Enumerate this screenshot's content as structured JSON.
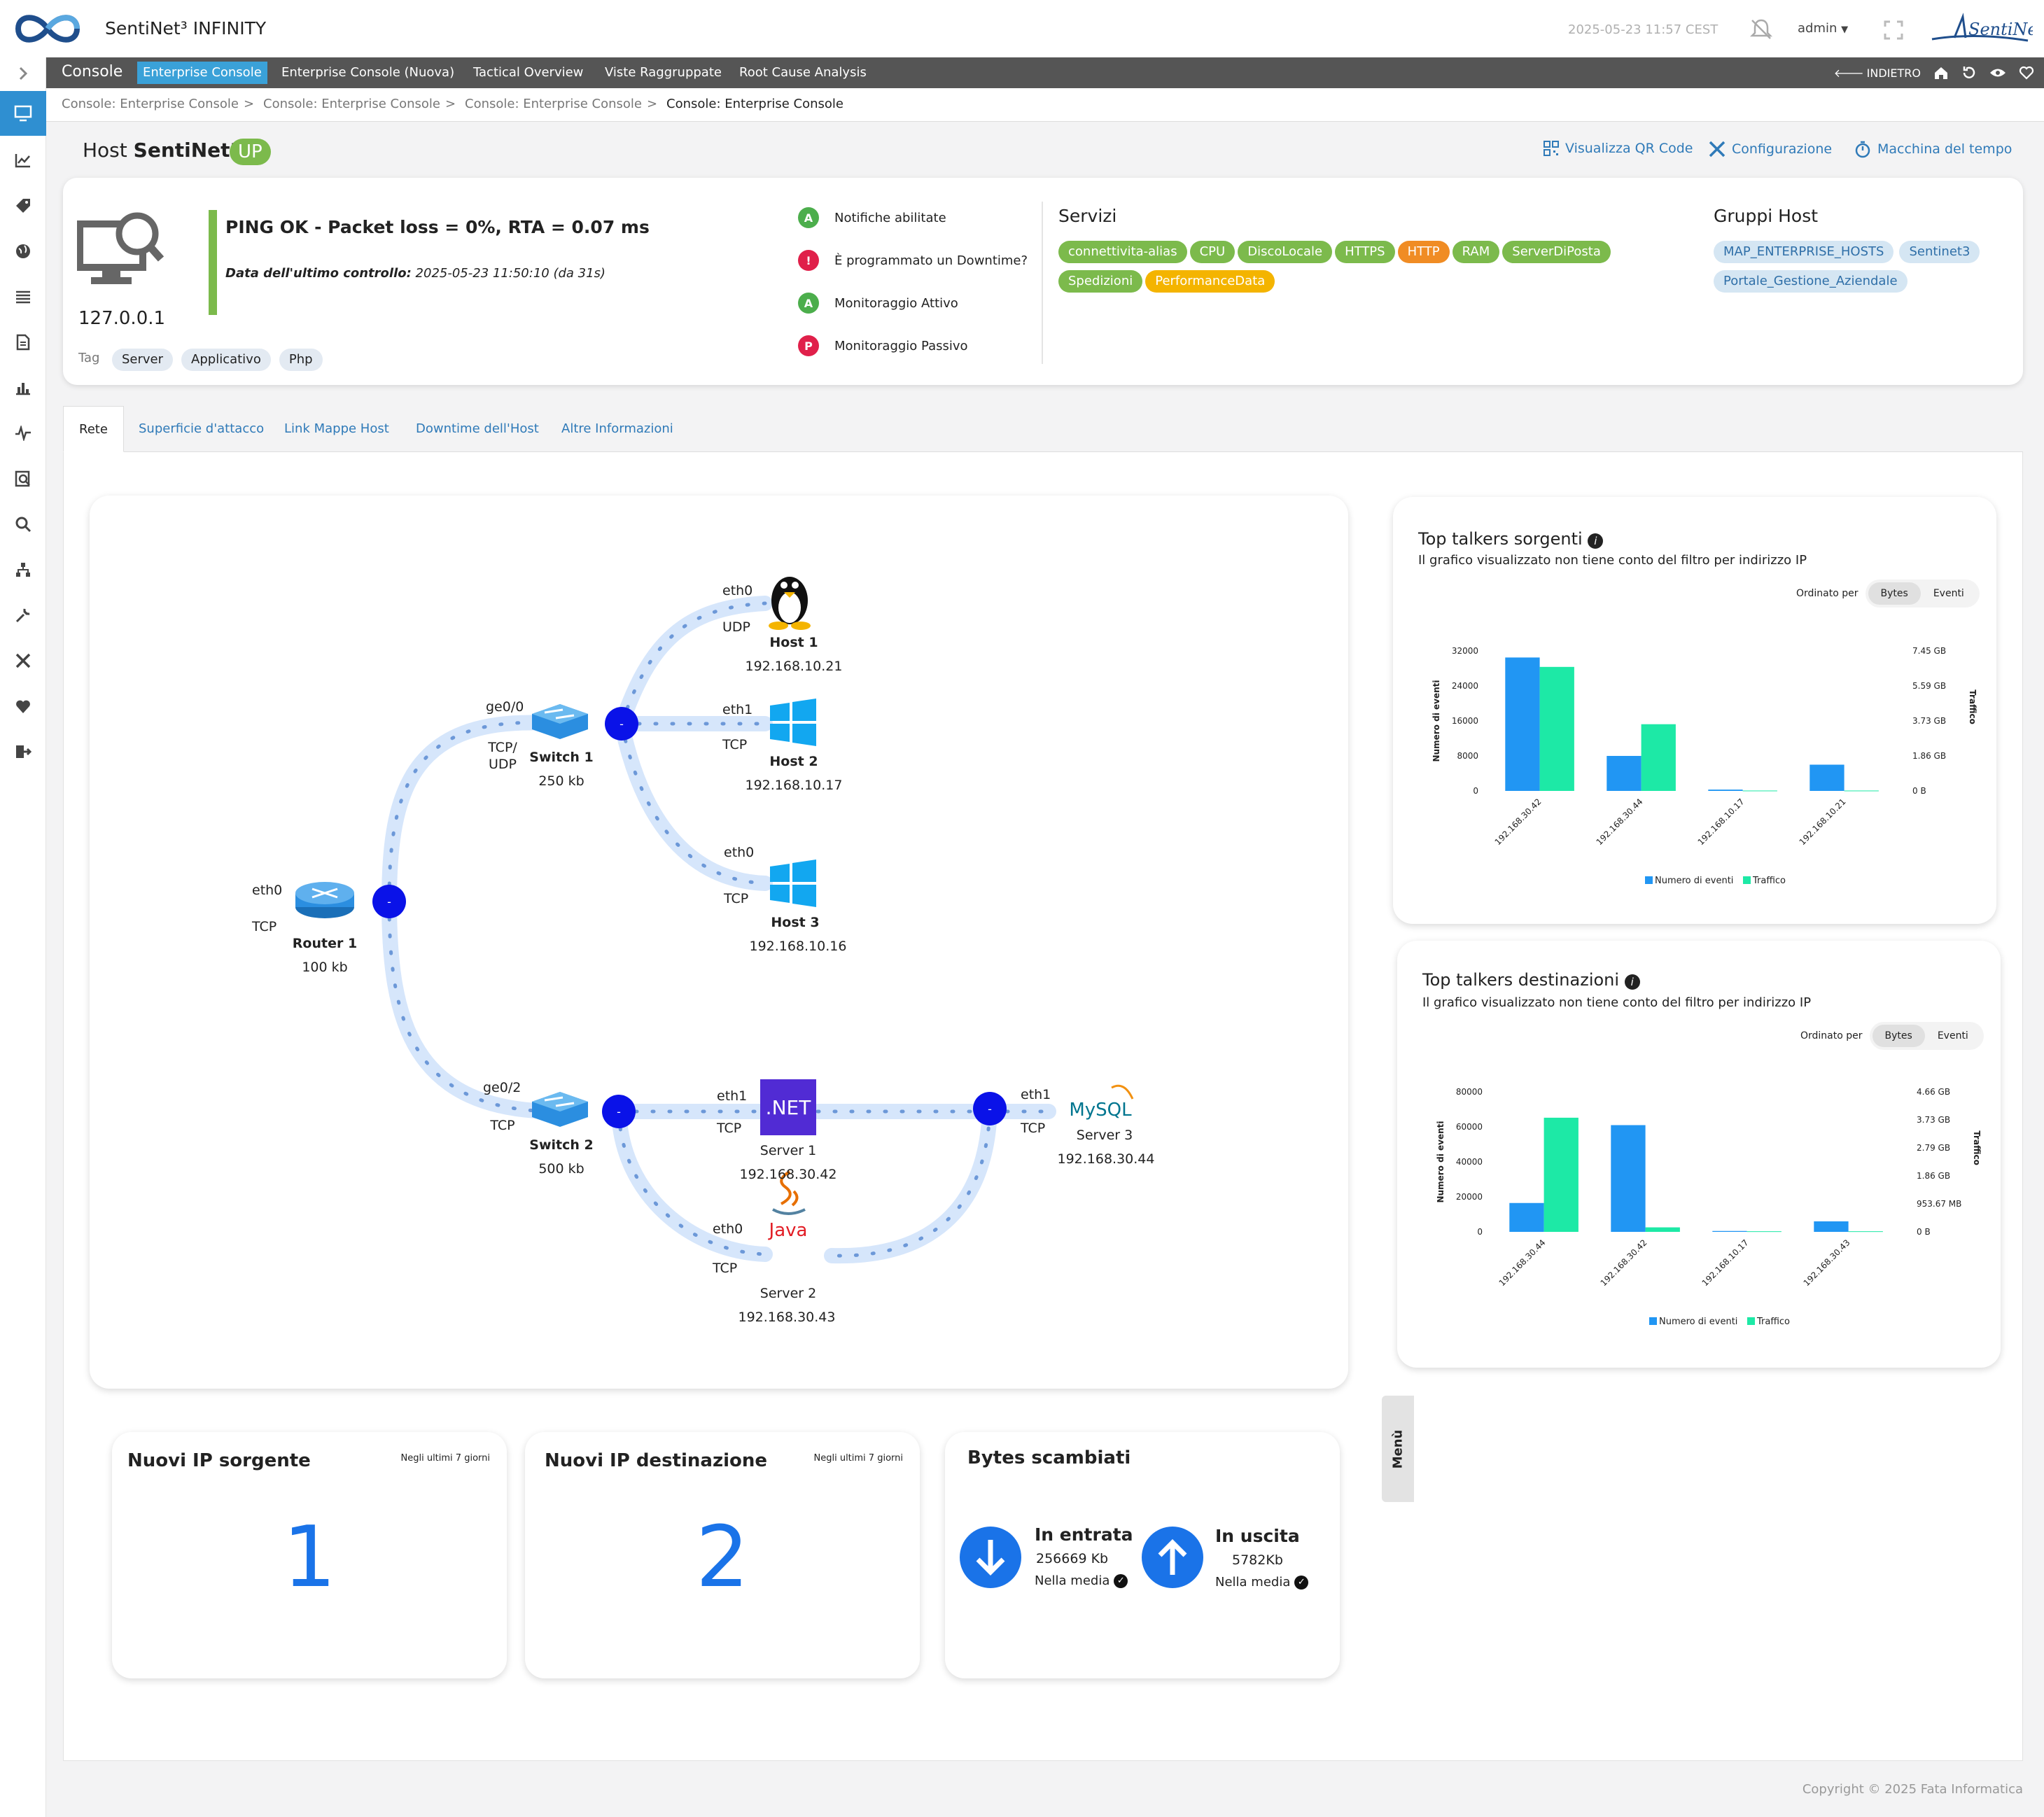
{
  "header": {
    "app_title": "SentiNet³ INFINITY",
    "datetime": "2025-05-23 11:57 CEST",
    "user": "admin"
  },
  "nav": {
    "console": "Console",
    "tabs": [
      "Enterprise Console",
      "Enterprise Console (Nuova)",
      "Tactical Overview",
      "Viste Raggruppate",
      "Root Cause Analysis"
    ],
    "back": "INDIETRO"
  },
  "breadcrumb": [
    "Console: Enterprise Console",
    "Console: Enterprise Console",
    "Console: Enterprise Console",
    "Console: Enterprise Console"
  ],
  "host": {
    "title_prefix": "Host",
    "name": "SentiNet3",
    "state": "UP",
    "ip": "127.0.0.1",
    "tag_label": "Tag",
    "tags": [
      "Server",
      "Applicativo",
      "Php"
    ],
    "check_output": "PING OK - Packet loss = 0%, RTA = 0.07 ms",
    "last_check_label": "Data dell'ultimo controllo:",
    "last_check_value": "2025-05-23 11:50:10  (da 31s)"
  },
  "actions": {
    "qr": "Visualizza QR Code",
    "config": "Configurazione",
    "time_machine": "Macchina del tempo"
  },
  "status_flags": [
    {
      "icon": "A",
      "label": "Notifiche abilitate",
      "color": "#4cae4c"
    },
    {
      "icon": "!",
      "label": "È programmato un Downtime?",
      "color": "#e0204a"
    },
    {
      "icon": "A",
      "label": "Monitoraggio Attivo",
      "color": "#4cae4c"
    },
    {
      "icon": "P",
      "label": "Monitoraggio Passivo",
      "color": "#e0204a"
    }
  ],
  "services": {
    "title": "Servizi",
    "items": [
      {
        "label": "connettivita-alias",
        "state": "ok"
      },
      {
        "label": "CPU",
        "state": "ok"
      },
      {
        "label": "DiscoLocale",
        "state": "ok"
      },
      {
        "label": "HTTPS",
        "state": "ok"
      },
      {
        "label": "HTTP",
        "state": "warning"
      },
      {
        "label": "RAM",
        "state": "ok"
      },
      {
        "label": "ServerDiPosta",
        "state": "ok"
      },
      {
        "label": "Spedizioni",
        "state": "ok"
      },
      {
        "label": "PerformanceData",
        "state": "pending"
      }
    ]
  },
  "groups": {
    "title": "Gruppi Host",
    "items": [
      "MAP_ENTERPRISE_HOSTS",
      "Sentinet3",
      "Portale_Gestione_Aziendale"
    ]
  },
  "tabs": [
    "Rete",
    "Superficie d'attacco",
    "Link Mappe Host",
    "Downtime dell'Host",
    "Altre Informazioni"
  ],
  "network": {
    "menu": "Menù",
    "router": {
      "name": "Router 1",
      "traffic": "100 kb",
      "iface": "eth0",
      "proto": "TCP"
    },
    "switch1": {
      "name": "Switch 1",
      "traffic": "250 kb",
      "iface": "ge0/0",
      "proto1": "TCP/",
      "proto2": "UDP"
    },
    "switch2": {
      "name": "Switch 2",
      "traffic": "500 kb",
      "iface": "ge0/2",
      "proto": "TCP"
    },
    "hosts": [
      {
        "name": "Host 1",
        "ip": "192.168.10.21",
        "iface": "eth0",
        "proto": "UDP"
      },
      {
        "name": "Host 2",
        "ip": "192.168.10.17",
        "iface": "eth1",
        "proto": "TCP"
      },
      {
        "name": "Host 3",
        "ip": "192.168.10.16",
        "iface": "eth0",
        "proto": "TCP"
      },
      {
        "name": "Server 1",
        "ip": "192.168.30.42",
        "iface": "eth1",
        "proto": "TCP",
        "logo": ".NET"
      },
      {
        "name": "Server 2",
        "ip": "192.168.30.43",
        "iface": "eth0",
        "proto": "TCP",
        "logo": "Java"
      },
      {
        "name": "Server 3",
        "ip": "192.168.30.44",
        "iface": "eth1",
        "proto": "TCP",
        "logo": "MySQL"
      }
    ],
    "node_dot": "-"
  },
  "talkers_src": {
    "title": "Top talkers sorgenti",
    "subtitle": "Il grafico visualizzato non tiene conto del filtro per indirizzo IP",
    "order_label": "Ordinato per",
    "toggle": [
      "Bytes",
      "Eventi"
    ]
  },
  "talkers_dst": {
    "title": "Top talkers destinazioni",
    "subtitle": "Il grafico visualizzato non tiene conto del filtro per indirizzo IP",
    "order_label": "Ordinato per",
    "toggle": [
      "Bytes",
      "Eventi"
    ]
  },
  "chart_data": [
    {
      "type": "bar",
      "title": "Top talkers sorgenti",
      "categories": [
        "192.168.30.42",
        "192.168.30.44",
        "192.168.10.17",
        "192.168.10.21"
      ],
      "series": [
        {
          "name": "Numero di eventi",
          "axis": "left",
          "values": [
            30500,
            8000,
            300,
            6000
          ],
          "color": "#2196f3"
        },
        {
          "name": "Traffico",
          "axis": "right",
          "values": [
            6.6,
            3.55,
            0.02,
            0.02
          ],
          "unit": "GB",
          "color": "#1de9a6"
        }
      ],
      "ylabel": "Numero di eventi",
      "y2label": "Traffico",
      "ylim": [
        0,
        32000
      ],
      "yticks": [
        "0",
        "8000",
        "16000",
        "24000",
        "32000"
      ],
      "y2lim": [
        0,
        7.45
      ],
      "y2ticks": [
        "0 B",
        "1.86 GB",
        "3.73 GB",
        "5.59 GB",
        "7.45 GB"
      ],
      "legend": "bottom",
      "grid": false
    },
    {
      "type": "bar",
      "title": "Top talkers destinazioni",
      "categories": [
        "192.168.30.44",
        "192.168.30.42",
        "192.168.10.17",
        "192.168.30.43"
      ],
      "series": [
        {
          "name": "Numero di eventi",
          "axis": "left",
          "values": [
            16500,
            61000,
            500,
            6000
          ],
          "color": "#2196f3"
        },
        {
          "name": "Traffico",
          "axis": "right",
          "values": [
            3.8,
            0.15,
            0.02,
            0.02
          ],
          "unit": "GB",
          "color": "#1de9a6"
        }
      ],
      "ylabel": "Numero di eventi",
      "y2label": "Traffico",
      "ylim": [
        0,
        80000
      ],
      "yticks": [
        "0",
        "20000",
        "40000",
        "60000",
        "80000"
      ],
      "y2lim": [
        0,
        4.66
      ],
      "y2ticks": [
        "0 B",
        "953.67 MB",
        "1.86 GB",
        "2.79 GB",
        "3.73 GB",
        "4.66 GB"
      ],
      "legend": "bottom",
      "grid": false
    }
  ],
  "stats": {
    "src": {
      "title": "Nuovi IP sorgente",
      "period": "Negli ultimi 7 giorni",
      "value": "1"
    },
    "dst": {
      "title": "Nuovi IP destinazione",
      "period": "Negli ultimi 7 giorni",
      "value": "2"
    },
    "bytes": {
      "title": "Bytes scambiati",
      "in_label": "In entrata",
      "in_value": "256669 Kb",
      "in_note": "Nella media",
      "out_label": "In uscita",
      "out_value": "5782Kb",
      "out_note": "Nella media"
    }
  },
  "footer": {
    "copyright": "Copyright © 2025 Fata Informatica"
  }
}
